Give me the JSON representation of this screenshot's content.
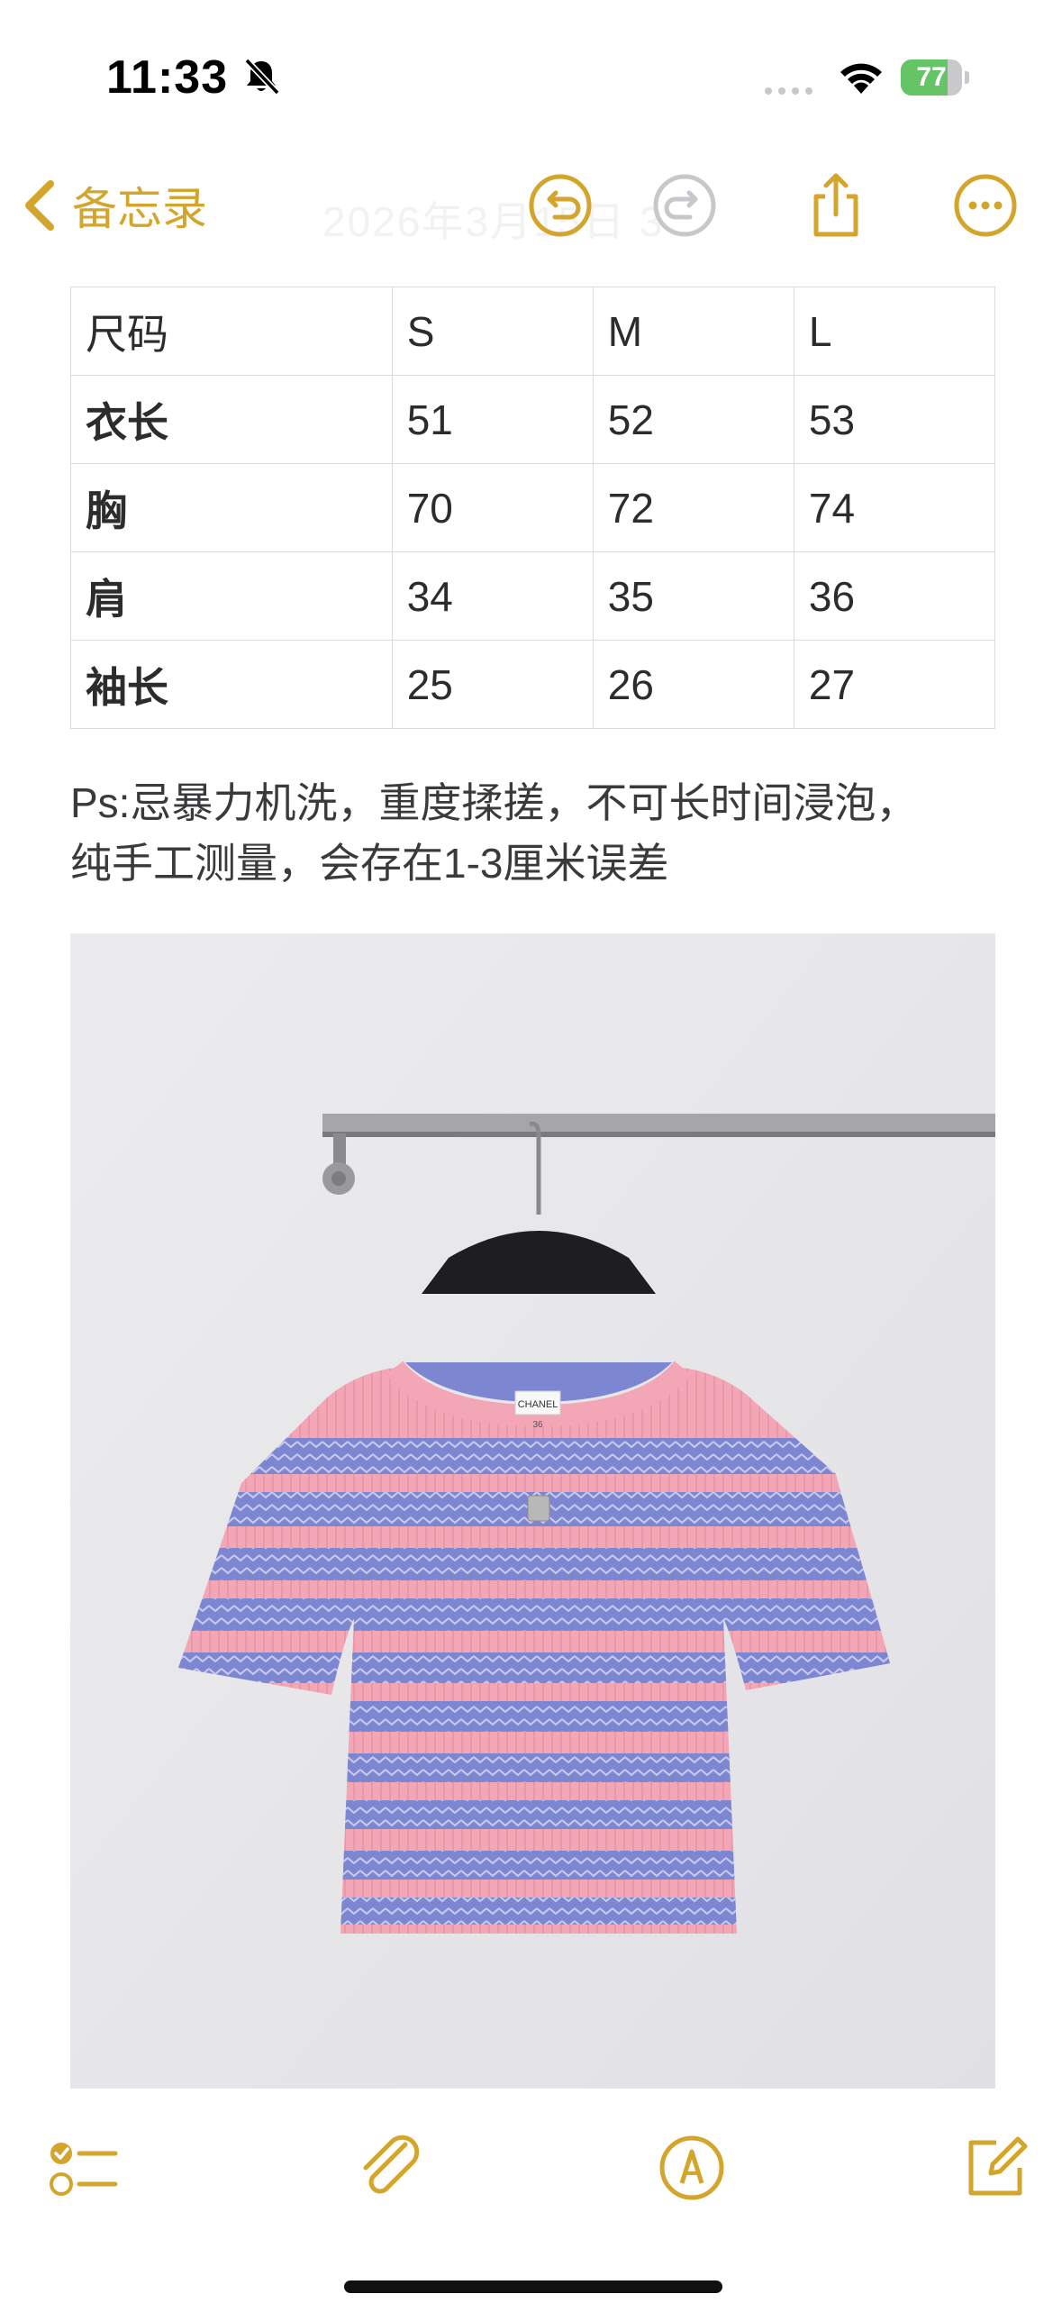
{
  "status_bar": {
    "time": "11:33",
    "battery_level": "77",
    "battery_fraction": 0.77,
    "silent_icon": "bell-slash-icon",
    "wifi_icon": "wifi-icon"
  },
  "nav": {
    "back_label": "备忘录",
    "date_title": "2026年3月15日 3",
    "icons": [
      "undo-icon",
      "redo-icon",
      "share-icon",
      "more-icon"
    ]
  },
  "size_table": {
    "columns": [
      "尺码",
      "S",
      "M",
      "L"
    ],
    "rows": [
      {
        "label": "衣长",
        "values": [
          "51",
          "52",
          "53"
        ]
      },
      {
        "label": "胸",
        "values": [
          "70",
          "72",
          "74"
        ]
      },
      {
        "label": "肩",
        "values": [
          "34",
          "35",
          "36"
        ]
      },
      {
        "label": "袖长",
        "values": [
          "25",
          "26",
          "27"
        ]
      }
    ]
  },
  "note": {
    "line1": "Ps:忌暴力机洗，重度揉搓，不可长时间浸泡，",
    "line2": "纯手工测量，会存在1-3厘米误差"
  },
  "photo": {
    "label_tag": "CHANEL",
    "label_size": "36"
  },
  "toolbar": {
    "icons": [
      "checklist-icon",
      "paperclip-icon",
      "markup-icon",
      "compose-icon"
    ]
  },
  "colors": {
    "accent": "#d4a52c",
    "sweater_pink": "#f3a6b5",
    "sweater_blue": "#7d86d0"
  }
}
